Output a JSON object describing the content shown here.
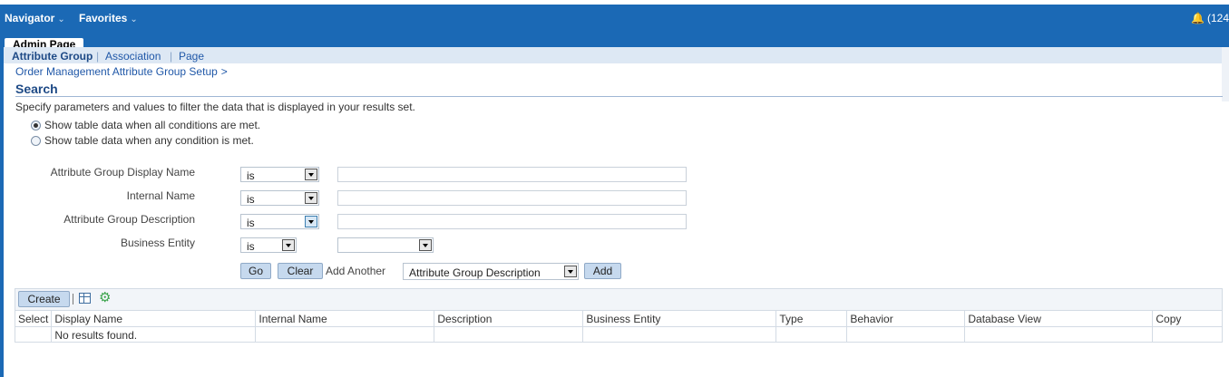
{
  "header": {
    "navigator_label": "Navigator",
    "favorites_label": "Favorites",
    "chevron": "⌄",
    "notifications_text": "(124",
    "notification_icon": "bell-icon",
    "brand_color": "#1b69b5"
  },
  "tabs": [
    {
      "label": "Admin Page"
    }
  ],
  "subnav": {
    "items": [
      {
        "label": "Attribute Group",
        "active": true
      },
      {
        "label": "Association"
      },
      {
        "label": "Page"
      }
    ],
    "separator": "|"
  },
  "breadcrumb": {
    "label": "Order Management Attribute Group Setup",
    "separator": ">"
  },
  "search": {
    "title": "Search",
    "instructions": "Specify parameters and values to filter the data that is displayed in your results set.",
    "match_all_label": "Show table data when all conditions are met.",
    "match_any_label": "Show table data when any condition is met.",
    "selected_mode": "all",
    "fields": [
      {
        "label": "Attribute Group Display Name",
        "operator": "is",
        "value": ""
      },
      {
        "label": "Internal Name",
        "operator": "is",
        "value": ""
      },
      {
        "label": "Attribute Group Description",
        "operator": "is",
        "value": ""
      },
      {
        "label": "Business Entity",
        "operator": "is",
        "value": ""
      }
    ],
    "go_label": "Go",
    "clear_label": "Clear",
    "add_another_label": "Add Another",
    "add_another_selected": "Attribute Group Description",
    "add_label": "Add"
  },
  "results": {
    "create_label": "Create",
    "toolbar_separator": "|",
    "columns": [
      "Select",
      "Display Name",
      "Internal Name",
      "Description",
      "Business Entity",
      "Type",
      "Behavior",
      "Database View",
      "Copy"
    ],
    "empty_message": "No results found."
  }
}
